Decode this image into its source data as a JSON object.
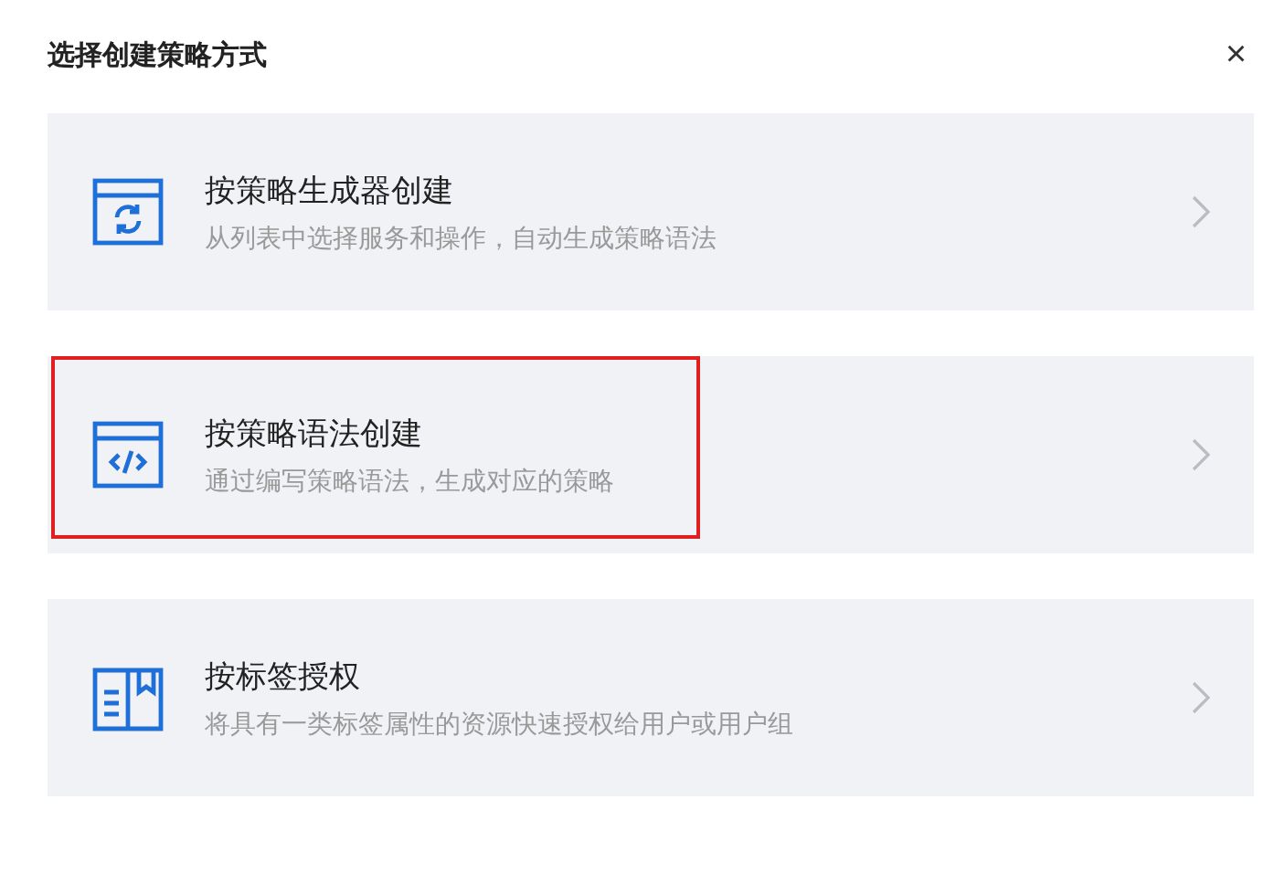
{
  "dialog": {
    "title": "选择创建策略方式",
    "close": "×"
  },
  "options": [
    {
      "kind": "generator",
      "title": "按策略生成器创建",
      "description": "从列表中选择服务和操作，自动生成策略语法",
      "highlighted": false
    },
    {
      "kind": "code",
      "title": "按策略语法创建",
      "description": "通过编写策略语法，生成对应的策略",
      "highlighted": true
    },
    {
      "kind": "tag",
      "title": "按标签授权",
      "description": "将具有一类标签属性的资源快速授权给用户或用户组",
      "highlighted": false
    }
  ]
}
